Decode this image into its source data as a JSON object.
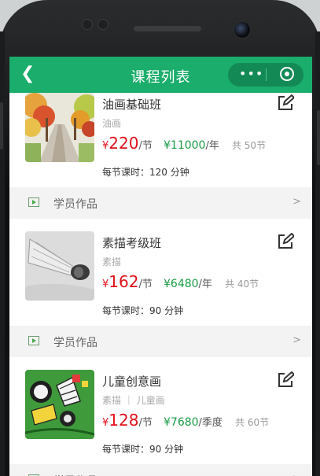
{
  "navbar": {
    "back_icon": "back-chevron-icon",
    "title": "课程列表",
    "more_icon": "more-dots-icon",
    "close_icon": "target-circle-icon"
  },
  "courses": [
    {
      "title": "油画基础班",
      "category": "油画",
      "price_currency": "¥",
      "price": "220",
      "price_unit": "/节",
      "package_price": "¥11000",
      "package_unit": "/年",
      "lessons": "共 50节",
      "duration": "每节课时：120 分钟",
      "thumb": "autumn-road-painting"
    },
    {
      "title": "素描考级班",
      "category": "素描",
      "price_currency": "¥",
      "price": "162",
      "price_unit": "/节",
      "package_price": "¥6480",
      "package_unit": "/年",
      "lessons": "共 40节",
      "duration": "每节课时：90 分钟",
      "thumb": "shuttlecock-sketch"
    },
    {
      "title": "儿童创意画",
      "category": "素描 ｜ 儿童画",
      "price_currency": "¥",
      "price": "128",
      "price_unit": "/节",
      "package_price": "¥7680",
      "package_unit": "/季度",
      "lessons": "共 60节",
      "duration": "每节课时：90 分钟",
      "thumb": "children-creative-drawing"
    }
  ],
  "works_bar": {
    "label": "学员作品",
    "arrow": ">"
  },
  "colors": {
    "brand_green": "#1aad6b",
    "price_red": "#e0101a",
    "package_green": "#1a9b45"
  }
}
